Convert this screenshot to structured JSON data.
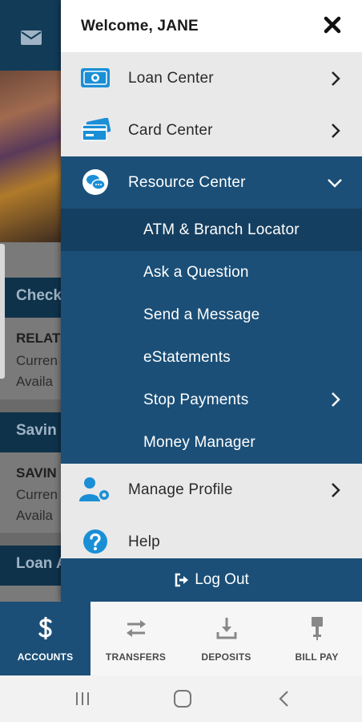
{
  "background": {
    "sections": [
      "Check",
      "Savin",
      "Loan A"
    ],
    "checking_rows": [
      "RELAT",
      "Curren",
      "Availa"
    ],
    "savings_rows": [
      "SAVIN",
      "Curren",
      "Availa"
    ]
  },
  "drawer": {
    "welcome": "Welcome, JANE",
    "items": [
      {
        "label": "Loan Center",
        "icon": "money-bill-icon"
      },
      {
        "label": "Card Center",
        "icon": "credit-card-icon"
      },
      {
        "label": "Resource Center",
        "icon": "chat-bubbles-icon",
        "expanded": true
      }
    ],
    "resource_submenu": [
      {
        "label": "ATM & Branch Locator",
        "active": true
      },
      {
        "label": "Ask a Question"
      },
      {
        "label": "Send a Message"
      },
      {
        "label": "eStatements"
      },
      {
        "label": "Stop Payments",
        "has_submenu": true
      },
      {
        "label": "Money Manager"
      }
    ],
    "bottom_items": [
      {
        "label": "Manage Profile",
        "icon": "user-gear-icon"
      },
      {
        "label": "Help",
        "icon": "question-circle-icon"
      }
    ],
    "logout": "Log Out"
  },
  "tabs": [
    {
      "label": "ACCOUNTS",
      "icon": "dollar-icon",
      "active": true
    },
    {
      "label": "TRANSFERS",
      "icon": "transfer-arrows-icon"
    },
    {
      "label": "DEPOSITS",
      "icon": "download-tray-icon"
    },
    {
      "label": "BILL PAY",
      "icon": "bill-stamp-icon"
    }
  ],
  "colors": {
    "primary": "#1b4f77",
    "active_sub": "#153f60",
    "icon_blue": "#1a8fd6"
  }
}
